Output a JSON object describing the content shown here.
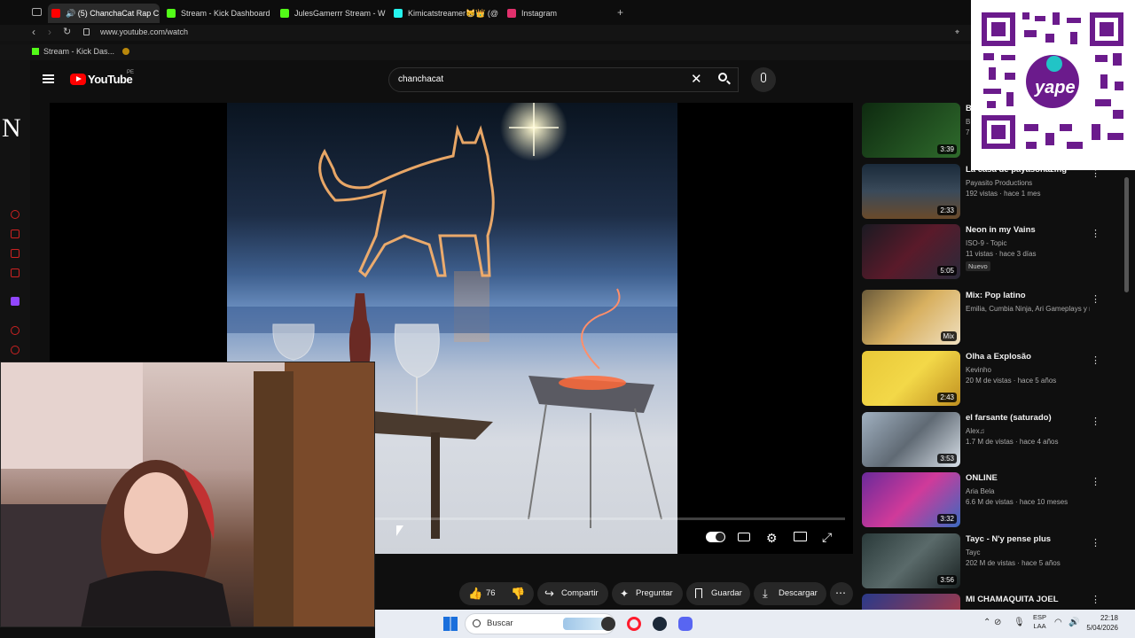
{
  "browser": {
    "tabs": [
      {
        "label": "🔊 (5) ChanchaCat Rap C",
        "active": true,
        "favicon_color": "#ff0000"
      },
      {
        "label": "Stream - Kick Dashboard",
        "active": false,
        "favicon_color": "#53fc18"
      },
      {
        "label": "JulesGamerrr Stream - W",
        "active": false,
        "favicon_color": "#53fc18"
      },
      {
        "label": "Kimicatstreamer😸👑 (@",
        "active": false,
        "favicon_color": "#25f4ee"
      },
      {
        "label": "Instagram",
        "active": false,
        "favicon_color": "#e1306c"
      }
    ],
    "url": "www.youtube.com/watch",
    "bookmark_label": "Stream - Kick Das..."
  },
  "youtube": {
    "logo_text": "YouTube",
    "region": "PE",
    "search_value": "chanchacat"
  },
  "player": {
    "cursor": "pointer"
  },
  "actions": {
    "likes": "76",
    "share": "Compartir",
    "ask": "Preguntar",
    "save": "Guardar",
    "download": "Descargar"
  },
  "recommendations": [
    {
      "title": "B",
      "channel": "B",
      "meta": "7",
      "duration": "3:39",
      "thumb": "#1c4a1c"
    },
    {
      "title": "La casa de payasonazing",
      "channel": "Payasito Productions",
      "meta": "192 vistas · hace 1 mes",
      "duration": "2:33",
      "thumb": "#2a3a4a"
    },
    {
      "title": "Neon in my Vains",
      "channel": "ISO-9 - Topic",
      "meta": "11 vistas · hace 3 días",
      "badge": "Nuevo",
      "duration": "5:05",
      "thumb": "#3a1a22"
    },
    {
      "title": "Mix: Pop latino",
      "channel": "Emilia, Cumbia Ninja, Ari Gameplays y m",
      "meta": "",
      "duration": "Mix",
      "thumb": "#b8904a"
    },
    {
      "title": "Olha a Explosão",
      "channel": "Kevinho",
      "meta": "20 M de vistas · hace 5 años",
      "duration": "2:43",
      "thumb": "#e8c030"
    },
    {
      "title": "el farsante (saturado)",
      "channel": "Alex♫",
      "meta": "1.7 M de vistas · hace 4 años",
      "duration": "3:53",
      "thumb": "#8a9aa8"
    },
    {
      "title": "ONLINE",
      "channel": "Aria Bela",
      "meta": "6.6 M de vistas · hace 10 meses",
      "duration": "3:32",
      "thumb": "#a02a8a"
    },
    {
      "title": "Tayc - N'y pense plus",
      "channel": "Tayc",
      "meta": "202 M de vistas · hace 5 años",
      "duration": "3:56",
      "thumb": "#3a4a4a"
    },
    {
      "title": "MI CHAMAQUITA   JOEL",
      "channel": "",
      "meta": "",
      "duration": "",
      "thumb": "#2a3a8a"
    }
  ],
  "taskbar": {
    "search_placeholder": "Buscar",
    "lang_top": "ESP",
    "lang_bottom": "LAA",
    "time": "22:18",
    "date": "5/04/2026"
  },
  "qr": {
    "brand": "yape"
  }
}
